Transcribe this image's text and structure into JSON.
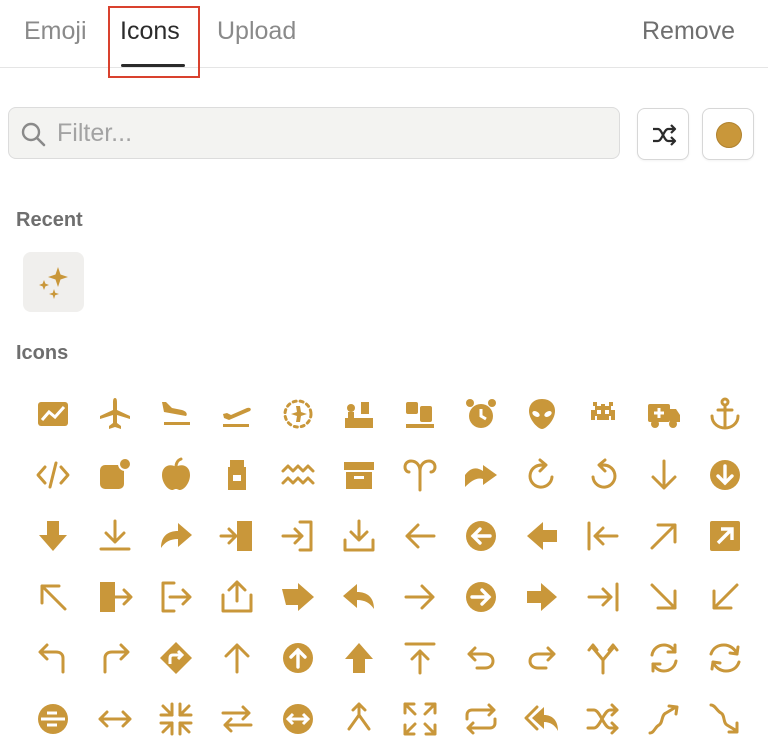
{
  "tabs": [
    {
      "label": "Emoji",
      "active": false
    },
    {
      "label": "Icons",
      "active": true
    },
    {
      "label": "Upload",
      "active": false
    }
  ],
  "remove_label": "Remove",
  "search": {
    "placeholder": "Filter...",
    "value": ""
  },
  "accent_color": "#c9973a",
  "highlight_color": "#d9412e",
  "sections": {
    "recent": "Recent",
    "icons": "Icons"
  },
  "recent_icons": [
    "sparkles-icon"
  ],
  "icon_rows": [
    [
      "chart-area-icon",
      "airplane-icon",
      "airplane-landing-icon",
      "airplane-takeoff-icon",
      "airplane-route-icon",
      "airport-checkin-icon",
      "baggage-claim-icon",
      "alarm-clock-icon",
      "alien-icon",
      "space-invader-icon",
      "ambulance-icon",
      "anchor-icon"
    ],
    [
      "code-icon",
      "app-badge-icon",
      "apple-icon",
      "apron-icon",
      "aquarius-icon",
      "archive-box-icon",
      "aries-icon",
      "arrow-bend-icon",
      "arrow-clockwise-icon",
      "arrow-counterclockwise-icon",
      "arrow-down-icon",
      "arrow-down-circle-icon"
    ],
    [
      "arrow-down-bold-icon",
      "download-icon",
      "arrow-forward-icon",
      "sign-in-door-icon",
      "sign-in-icon",
      "download-tray-icon",
      "arrow-left-icon",
      "arrow-left-circle-icon",
      "arrow-left-bold-icon",
      "arrow-left-to-line-icon",
      "arrow-up-right-icon",
      "arrow-up-right-square-icon"
    ],
    [
      "arrow-up-left-icon",
      "sign-out-door-icon",
      "sign-out-icon",
      "share-upload-icon",
      "arrow-right-square-icon",
      "reply-icon",
      "arrow-right-icon",
      "arrow-right-circle-icon",
      "arrow-right-bold-icon",
      "arrow-right-to-line-icon",
      "arrow-down-right-icon",
      "arrow-down-left-icon"
    ],
    [
      "arrow-turn-left-icon",
      "arrow-turn-right-icon",
      "arrow-right-diamond-icon",
      "arrow-up-icon",
      "arrow-up-circle-icon",
      "arrow-up-bold-icon",
      "arrow-up-from-line-icon",
      "arrow-u-turn-left-icon",
      "arrow-u-turn-right-icon",
      "arrow-split-icon",
      "arrows-rotate-icon",
      "arrows-cycle-icon"
    ],
    [
      "arrow-detour-circle-icon",
      "arrows-left-right-icon",
      "arrows-compress-icon",
      "arrows-swap-icon",
      "arrows-left-right-circle-icon",
      "arrow-merge-icon",
      "arrows-expand-icon",
      "arrows-repeat-icon",
      "reply-all-icon",
      "shuffle-icon",
      "arrow-wave-icon",
      "arrow-zigzag-icon"
    ]
  ]
}
